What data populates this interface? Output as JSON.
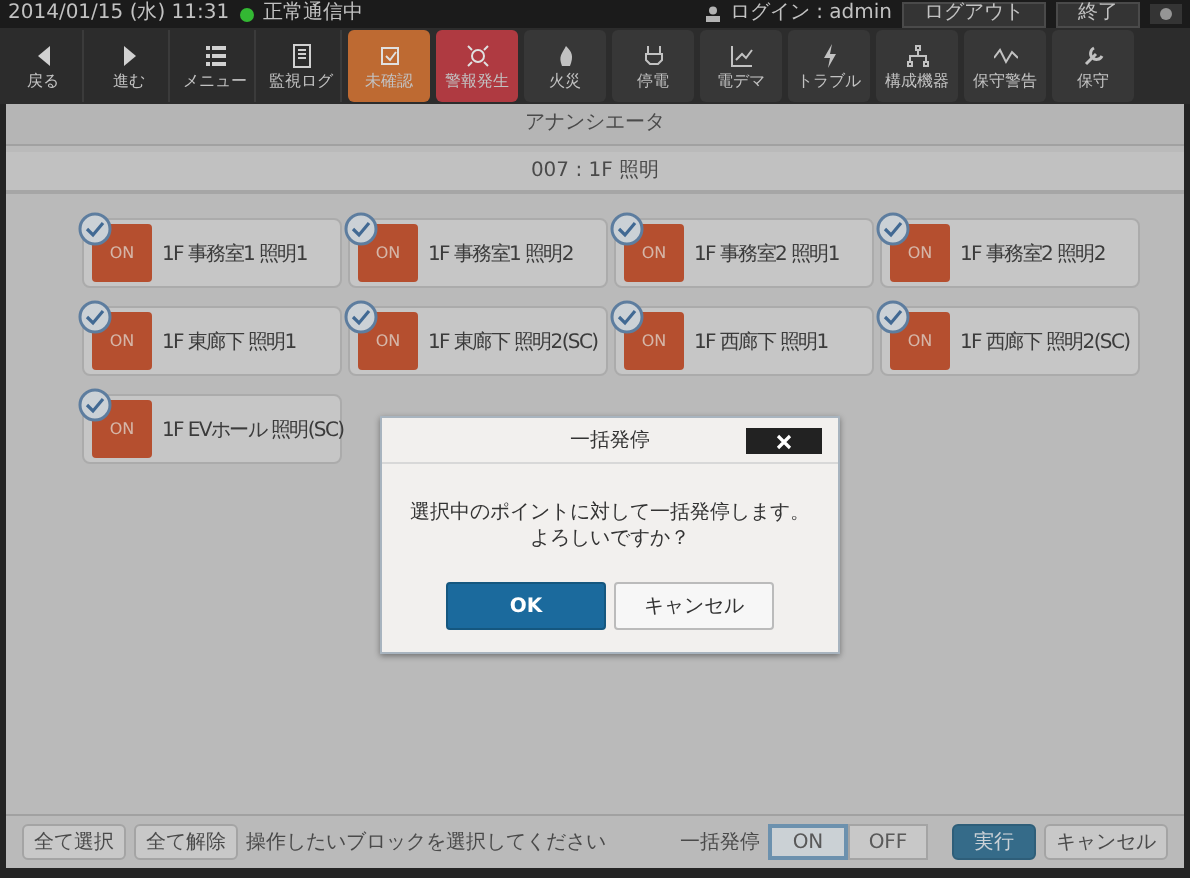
{
  "status_bar": {
    "datetime": "2014/01/15 (水) 11:31",
    "connected": true,
    "status": "正常通信中",
    "login": "ログイン : admin",
    "buttons": [
      "ログアウト",
      "終了"
    ]
  },
  "toolbar": [
    {
      "label": "戻る",
      "kind": "plain"
    },
    {
      "label": "進む",
      "kind": "plain"
    },
    {
      "label": "メニュー",
      "kind": "plain"
    },
    {
      "label": "監視ログ",
      "kind": "plain"
    },
    {
      "label": "未確認",
      "kind": "warning"
    },
    {
      "label": "警報発生",
      "kind": "alarm"
    },
    {
      "label": "火災",
      "kind": "tile"
    },
    {
      "label": "停電",
      "kind": "tile"
    },
    {
      "label": "電デマ",
      "kind": "tile"
    },
    {
      "label": "トラブル",
      "kind": "tile"
    },
    {
      "label": "構成機器",
      "kind": "tile"
    },
    {
      "label": "保守警告",
      "kind": "tile"
    },
    {
      "label": "保守",
      "kind": "tile"
    }
  ],
  "page_title": "アナンシエータ",
  "group_title": "007 : 1F 照明",
  "points": [
    {
      "state": "ON",
      "name": "1F 事務室1 照明1",
      "checked": true
    },
    {
      "state": "ON",
      "name": "1F 事務室1 照明2",
      "checked": true
    },
    {
      "state": "ON",
      "name": "1F 事務室2 照明1",
      "checked": true
    },
    {
      "state": "ON",
      "name": "1F 事務室2 照明2",
      "checked": true
    },
    {
      "state": "ON",
      "name": "1F 東廊下 照明1",
      "checked": true
    },
    {
      "state": "ON",
      "name": "1F 東廊下 照明2(SC)",
      "checked": true
    },
    {
      "state": "ON",
      "name": "1F 西廊下 照明1",
      "checked": true
    },
    {
      "state": "ON",
      "name": "1F 西廊下 照明2(SC)",
      "checked": true
    },
    {
      "state": "ON",
      "name": "1F EVホール 照明(SC)",
      "checked": true
    }
  ],
  "bottom_bar": {
    "select_all": "全て選択",
    "clear_all": "全て解除",
    "hint": "操作したいブロックを選択してください",
    "mode_label": "一括発停",
    "modes": [
      {
        "label": "ON",
        "selected": true
      },
      {
        "label": "OFF",
        "selected": false
      }
    ],
    "execute": "実行",
    "cancel": "キャンセル"
  },
  "dialog": {
    "title": "一括発停",
    "message": [
      "選択中のポイントに対して一括発停します。",
      "よろしいですか？"
    ],
    "ok": "OK",
    "cancel": "キャンセル"
  }
}
